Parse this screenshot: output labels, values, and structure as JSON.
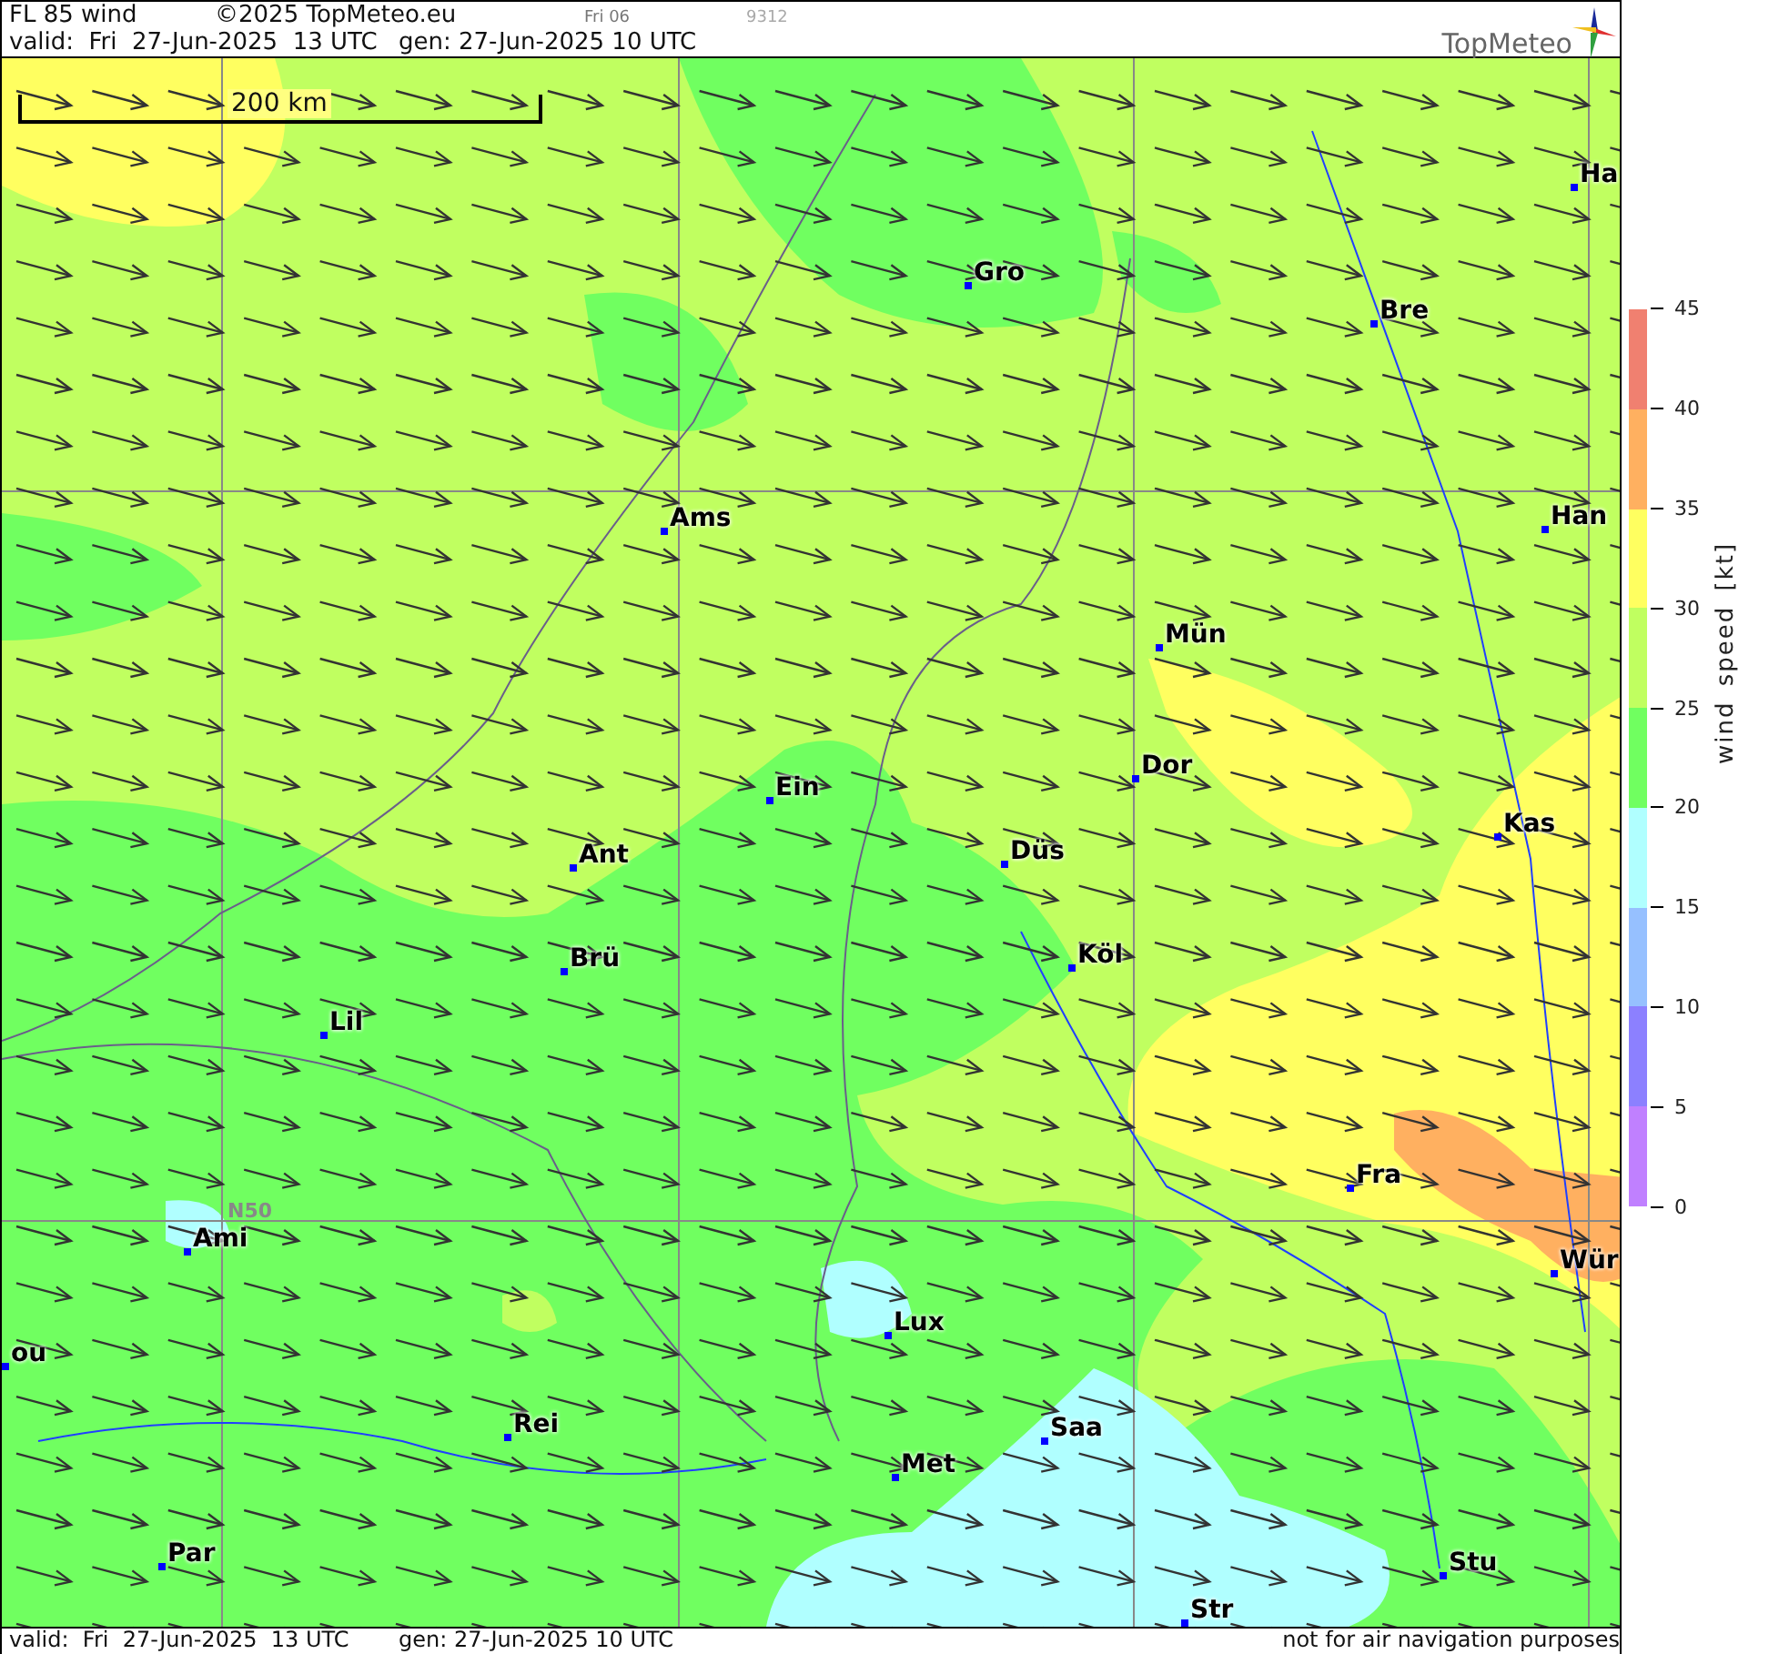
{
  "header": {
    "title": "FL 85 wind",
    "copyright": "©2025 TopMeteo.eu",
    "day_code": "Fri 06",
    "run_code": "9312",
    "valid": "valid:  Fri  27-Jun-2025  13 UTC",
    "generated": "gen: 27-Jun-2025 10 UTC",
    "logo": "TopMeteo"
  },
  "map": {
    "scale_label": "200 km",
    "latitude_label": "N50",
    "cities": [
      {
        "name": "Ha"
      },
      {
        "name": "Gro"
      },
      {
        "name": "Bre"
      },
      {
        "name": "Ams"
      },
      {
        "name": "Han"
      },
      {
        "name": "Mün"
      },
      {
        "name": "Dor"
      },
      {
        "name": "Ein"
      },
      {
        "name": "Kas"
      },
      {
        "name": "Ant"
      },
      {
        "name": "Düs"
      },
      {
        "name": "Köl"
      },
      {
        "name": "Brü"
      },
      {
        "name": "Lil"
      },
      {
        "name": "Fra"
      },
      {
        "name": "Ami"
      },
      {
        "name": "Wür"
      },
      {
        "name": "Lux"
      },
      {
        "name": "Saa"
      },
      {
        "name": "Rei"
      },
      {
        "name": "Met"
      },
      {
        "name": "Par"
      },
      {
        "name": "Stu"
      },
      {
        "name": "Str"
      },
      {
        "name": "ou"
      }
    ]
  },
  "legend": {
    "title": "wind speed [kt]",
    "bands": [
      {
        "color": "#f08070"
      },
      {
        "color": "#ffb060"
      },
      {
        "color": "#ffff60"
      },
      {
        "color": "#c0ff60"
      },
      {
        "color": "#70ff60"
      },
      {
        "color": "#b0ffff"
      },
      {
        "color": "#96c0ff"
      },
      {
        "color": "#8c80ff"
      },
      {
        "color": "#c080ff"
      }
    ],
    "ticks": [
      "45",
      "40",
      "35",
      "30",
      "25",
      "20",
      "15",
      "10",
      "5",
      "0"
    ]
  },
  "footer": {
    "valid": "valid:  Fri  27-Jun-2025  13 UTC",
    "generated": "gen: 27-Jun-2025 10 UTC",
    "disclaimer": "not for air navigation purposes"
  }
}
